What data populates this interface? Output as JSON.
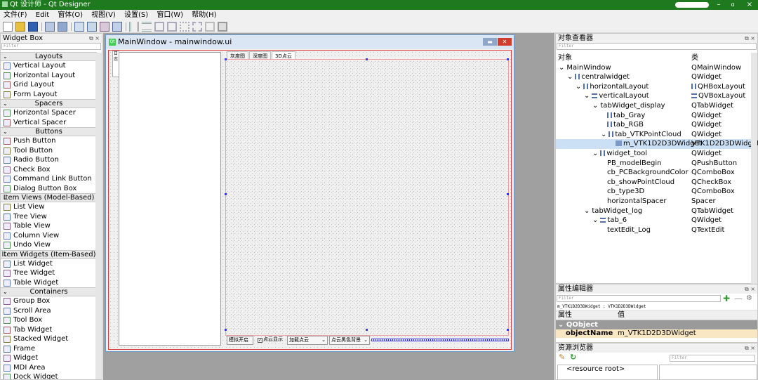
{
  "window": {
    "title": "Qt 设计师 - Qt Designer",
    "minimize": "–",
    "maximize": "ɑ",
    "close": "×"
  },
  "menu": [
    "文件(F)",
    "Edit",
    "窗体(O)",
    "视图(V)",
    "设置(S)",
    "窗口(W)",
    "帮助(H)"
  ],
  "widget_box": {
    "title": "Widget Box",
    "filter_placeholder": "Filter",
    "sections": [
      {
        "name": "Layouts",
        "items": [
          {
            "label": "Vertical Layout",
            "icon": "vertical-layout-icon"
          },
          {
            "label": "Horizontal Layout",
            "icon": "horizontal-layout-icon"
          },
          {
            "label": "Grid Layout",
            "icon": "grid-layout-icon"
          },
          {
            "label": "Form Layout",
            "icon": "form-layout-icon"
          }
        ]
      },
      {
        "name": "Spacers",
        "items": [
          {
            "label": "Horizontal Spacer",
            "icon": "horizontal-spacer-icon"
          },
          {
            "label": "Vertical Spacer",
            "icon": "vertical-spacer-icon"
          }
        ]
      },
      {
        "name": "Buttons",
        "items": [
          {
            "label": "Push Button",
            "icon": "push-button-icon"
          },
          {
            "label": "Tool Button",
            "icon": "tool-button-icon"
          },
          {
            "label": "Radio Button",
            "icon": "radio-button-icon"
          },
          {
            "label": "Check Box",
            "icon": "check-box-icon"
          },
          {
            "label": "Command Link Button",
            "icon": "command-link-icon"
          },
          {
            "label": "Dialog Button Box",
            "icon": "dialog-button-box-icon"
          }
        ]
      },
      {
        "name": "Item Views (Model-Based)",
        "items": [
          {
            "label": "List View",
            "icon": "list-view-icon"
          },
          {
            "label": "Tree View",
            "icon": "tree-view-icon"
          },
          {
            "label": "Table View",
            "icon": "table-view-icon"
          },
          {
            "label": "Column View",
            "icon": "column-view-icon"
          },
          {
            "label": "Undo View",
            "icon": "undo-view-icon"
          }
        ]
      },
      {
        "name": "Item Widgets (Item-Based)",
        "items": [
          {
            "label": "List Widget",
            "icon": "list-widget-icon"
          },
          {
            "label": "Tree Widget",
            "icon": "tree-widget-icon"
          },
          {
            "label": "Table Widget",
            "icon": "table-widget-icon"
          }
        ]
      },
      {
        "name": "Containers",
        "items": [
          {
            "label": "Group Box",
            "icon": "group-box-icon"
          },
          {
            "label": "Scroll Area",
            "icon": "scroll-area-icon"
          },
          {
            "label": "Tool Box",
            "icon": "tool-box-icon"
          },
          {
            "label": "Tab Widget",
            "icon": "tab-widget-icon"
          },
          {
            "label": "Stacked Widget",
            "icon": "stacked-widget-icon"
          },
          {
            "label": "Frame",
            "icon": "frame-icon"
          },
          {
            "label": "Widget",
            "icon": "widget-icon"
          },
          {
            "label": "MDI Area",
            "icon": "mdi-area-icon"
          },
          {
            "label": "Dock Widget",
            "icon": "dock-widget-icon"
          }
        ]
      }
    ]
  },
  "form": {
    "title": "MainWindow - mainwindow.ui",
    "tabs": [
      "灰度图",
      "深度图",
      "3D点云"
    ],
    "side_tab": "日志",
    "toolbar": {
      "model_button": "模拟开启",
      "checkbox": "点云显示",
      "combo_type": "加载点云",
      "combo_bg": "点云黑色背景"
    }
  },
  "object_inspector": {
    "title": "对象查看器",
    "filter_placeholder": "Filter",
    "col_object": "对象",
    "col_class": "类",
    "rows": [
      {
        "obj": "MainWindow",
        "cls": "QMainWindow",
        "depth": 0,
        "arrow": "⌄",
        "icon": ""
      },
      {
        "obj": "centralwidget",
        "cls": "QWidget",
        "depth": 1,
        "arrow": "⌄",
        "icon": "h"
      },
      {
        "obj": "horizontalLayout",
        "cls": "QHBoxLayout",
        "depth": 2,
        "arrow": "⌄",
        "icon": "h",
        "clsicon": "h"
      },
      {
        "obj": "verticalLayout",
        "cls": "QVBoxLayout",
        "depth": 3,
        "arrow": "⌄",
        "icon": "v",
        "clsicon": "v"
      },
      {
        "obj": "tabWidget_display",
        "cls": "QTabWidget",
        "depth": 4,
        "arrow": "⌄",
        "icon": ""
      },
      {
        "obj": "tab_Gray",
        "cls": "QWidget",
        "depth": 5,
        "arrow": "",
        "icon": "h"
      },
      {
        "obj": "tab_RGB",
        "cls": "QWidget",
        "depth": 5,
        "arrow": "",
        "icon": "h"
      },
      {
        "obj": "tab_VTKPointCloud",
        "cls": "QWidget",
        "depth": 5,
        "arrow": "⌄",
        "icon": "h"
      },
      {
        "obj": "m_VTK1D2D3DWidget",
        "cls": "VTK1D2D3DWidget",
        "depth": 6,
        "arrow": "",
        "icon": "w",
        "selected": true
      },
      {
        "obj": "widget_tool",
        "cls": "QWidget",
        "depth": 4,
        "arrow": "⌄",
        "icon": "h"
      },
      {
        "obj": "PB_modelBegin",
        "cls": "QPushButton",
        "depth": 5,
        "arrow": "",
        "icon": ""
      },
      {
        "obj": "cb_PCBackgroundColor",
        "cls": "QComboBox",
        "depth": 5,
        "arrow": "",
        "icon": ""
      },
      {
        "obj": "cb_showPointCloud",
        "cls": "QCheckBox",
        "depth": 5,
        "arrow": "",
        "icon": ""
      },
      {
        "obj": "cb_type3D",
        "cls": "QComboBox",
        "depth": 5,
        "arrow": "",
        "icon": ""
      },
      {
        "obj": "horizontalSpacer",
        "cls": "Spacer",
        "depth": 5,
        "arrow": "",
        "icon": ""
      },
      {
        "obj": "tabWidget_log",
        "cls": "QTabWidget",
        "depth": 3,
        "arrow": "⌄",
        "icon": ""
      },
      {
        "obj": "tab_6",
        "cls": "QWidget",
        "depth": 4,
        "arrow": "⌄",
        "icon": "v"
      },
      {
        "obj": "textEdit_Log",
        "cls": "QTextEdit",
        "depth": 5,
        "arrow": "",
        "icon": ""
      }
    ]
  },
  "property_editor": {
    "title": "属性编辑器",
    "filter_placeholder": "Filter",
    "context": "m_VTK1D2D3DWidget : VTK1D2D3DWidget",
    "col_prop": "属性",
    "col_value": "值",
    "group": "QObject",
    "object_name_label": "objectName",
    "object_name_value": "m_VTK1D2D3DWidget"
  },
  "resource_browser": {
    "title": "资源浏览器",
    "filter_placeholder": "Filter",
    "root": "<resource root>"
  },
  "colors": {
    "titlebar": "#1f7a1f",
    "selection": "#cce0f5",
    "layout_red": "#e03c3c",
    "handle": "#3a3ae0"
  }
}
